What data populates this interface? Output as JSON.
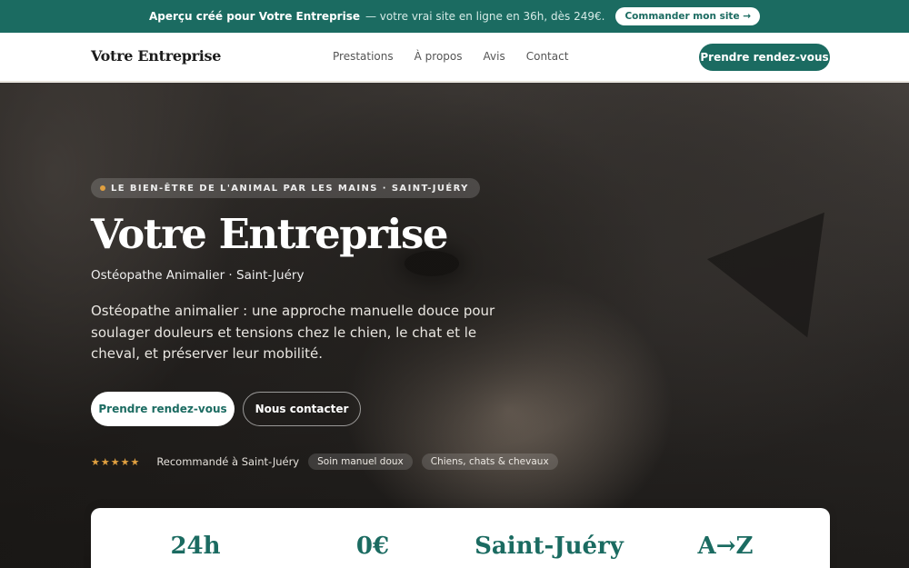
{
  "promo": {
    "bold_text": "Aperçu créé pour Votre Entreprise",
    "text": "— votre vrai site en ligne en 36h, dès 249€.",
    "button": "Commander mon site →"
  },
  "nav": {
    "brand": "Votre Entreprise",
    "links": [
      "Prestations",
      "À propos",
      "Avis",
      "Contact"
    ],
    "cta": "Prendre rendez-vous"
  },
  "hero": {
    "eyebrow": "LE BIEN-ÊTRE DE L'ANIMAL PAR LES MAINS · SAINT-JUÉRY",
    "title": "Votre Entreprise",
    "subtitle": "Ostéopathe Animalier · Saint-Juéry",
    "description": "Ostéopathe animalier : une approche manuelle douce pour soulager douleurs et tensions chez le chien, le chat et le cheval, et préserver leur mobilité.",
    "primary_button": "Prendre rendez-vous",
    "secondary_button": "Nous contacter",
    "stars": "★★★★★",
    "recommendation": "Recommandé à Saint-Juéry",
    "tags": [
      "Soin manuel doux",
      "Chiens, chats & chevaux"
    ]
  },
  "stats": [
    "24h",
    "0€",
    "Saint-Juéry",
    "A→Z"
  ],
  "colors": {
    "accent": "#1b6b61",
    "star": "#e0a040"
  }
}
